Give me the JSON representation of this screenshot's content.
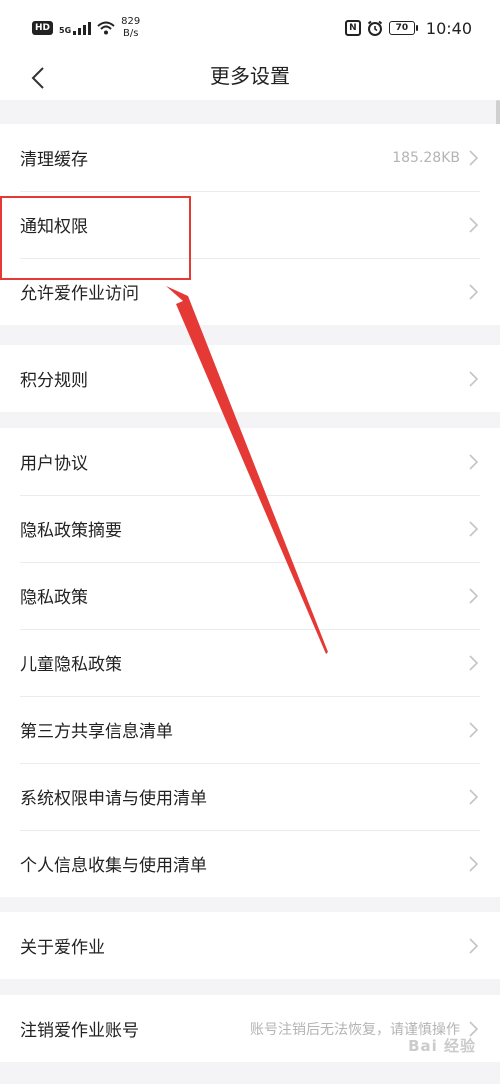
{
  "status_bar": {
    "hd": "HD",
    "signal_label": "5G",
    "net_speed_value": "829",
    "net_speed_unit": "B/s",
    "nfc": "N",
    "battery": "70",
    "time": "10:40"
  },
  "nav": {
    "title": "更多设置"
  },
  "groups": {
    "storage": {
      "items": [
        {
          "label": "清理缓存",
          "value": "185.28KB"
        },
        {
          "label": "通知权限"
        },
        {
          "label": "允许爱作业访问"
        }
      ]
    },
    "points": {
      "items": [
        {
          "label": "积分规则"
        }
      ]
    },
    "legal": {
      "items": [
        {
          "label": "用户协议"
        },
        {
          "label": "隐私政策摘要"
        },
        {
          "label": "隐私政策"
        },
        {
          "label": "儿童隐私政策"
        },
        {
          "label": "第三方共享信息清单"
        },
        {
          "label": "系统权限申请与使用清单"
        },
        {
          "label": "个人信息收集与使用清单"
        }
      ]
    },
    "about": {
      "items": [
        {
          "label": "关于爱作业"
        }
      ]
    },
    "account": {
      "items": [
        {
          "label": "注销爱作业账号",
          "value": "账号注销后无法恢复，请谨慎操作"
        }
      ]
    }
  },
  "watermark": "Bai 经验",
  "colors": {
    "annotation": "#e53935",
    "background": "#f4f4f6",
    "value_text": "#b4b4b4"
  }
}
